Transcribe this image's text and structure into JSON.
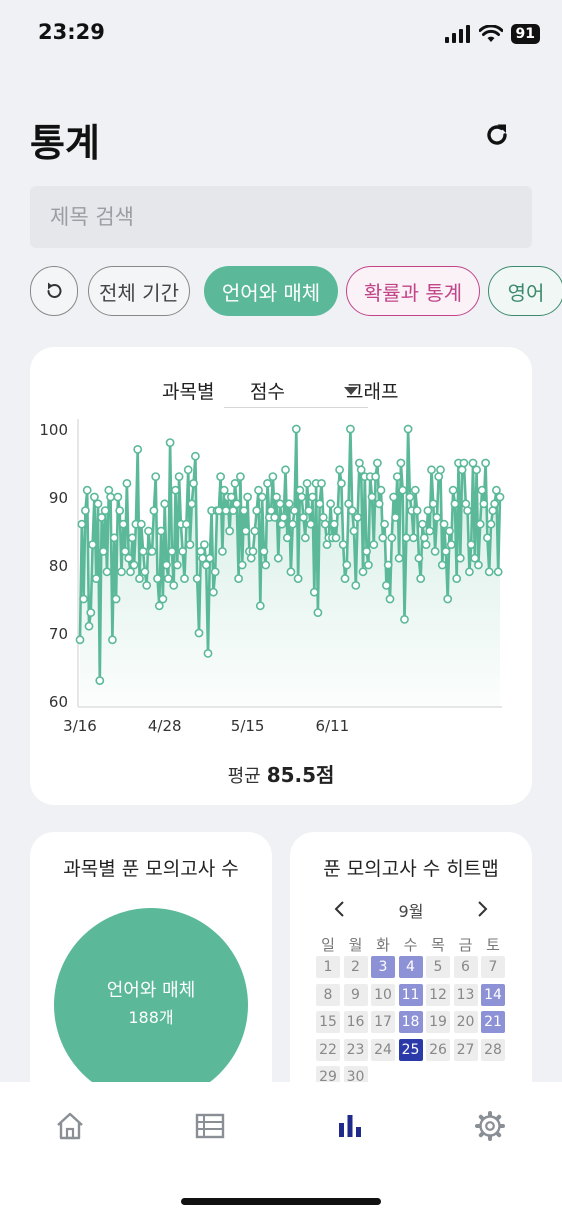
{
  "status_bar": {
    "time": "23:29",
    "battery": "91"
  },
  "header": {
    "title": "통계"
  },
  "search": {
    "placeholder": "제목 검색",
    "value": ""
  },
  "filters": {
    "reset_icon": "undo-icon",
    "chips": [
      {
        "label": "전체 기간",
        "active": false,
        "color": "#555555"
      },
      {
        "label": "언어와 매체",
        "active": true,
        "color": "#5bb99a"
      },
      {
        "label": "확률과 통계",
        "active": false,
        "color": "#c2458a"
      },
      {
        "label": "영어",
        "active": false,
        "color": "#3c8a6e"
      }
    ]
  },
  "chart_section": {
    "prefix": "과목별",
    "metric": "점수",
    "suffix": "그래프",
    "average_label": "평균",
    "average_value": "85.5점"
  },
  "chart_data": {
    "type": "line",
    "color": "#5bb99a",
    "ylim": [
      60,
      100
    ],
    "yticks": [
      60,
      70,
      80,
      90,
      100
    ],
    "xticks": [
      {
        "index": 0,
        "label": "3/16"
      },
      {
        "index": 47,
        "label": "4/28"
      },
      {
        "index": 93,
        "label": "5/15"
      },
      {
        "index": 140,
        "label": "6/11"
      }
    ],
    "values": [
      69,
      86,
      75,
      88,
      91,
      71,
      73,
      83,
      90,
      78,
      89,
      63,
      87,
      82,
      88,
      79,
      91,
      90,
      69,
      84,
      75,
      90,
      88,
      79,
      86,
      82,
      92,
      81,
      79,
      84,
      80,
      86,
      97,
      78,
      86,
      82,
      79,
      77,
      85,
      82,
      82,
      88,
      93,
      78,
      74,
      85,
      75,
      89,
      80,
      78,
      98,
      82,
      77,
      91,
      80,
      93,
      86,
      82,
      78,
      86,
      94,
      83,
      89,
      92,
      96,
      78,
      70,
      82,
      81,
      83,
      80,
      67,
      81,
      88,
      76,
      79,
      88,
      88,
      93,
      82,
      91,
      88,
      90,
      85,
      90,
      88,
      92,
      89,
      78,
      93,
      80,
      88,
      85,
      90,
      82,
      81,
      82,
      85,
      88,
      91,
      74,
      90,
      82,
      80,
      92,
      87,
      88,
      93,
      87,
      90,
      81,
      89,
      86,
      87,
      94,
      84,
      89,
      79,
      86,
      88,
      100,
      78,
      91,
      90,
      87,
      84,
      92,
      88,
      86,
      90,
      76,
      92,
      73,
      89,
      92,
      87,
      86,
      83,
      84,
      89,
      84,
      86,
      84,
      88,
      94,
      92,
      83,
      78,
      80,
      89,
      100,
      88,
      85,
      77,
      87,
      95,
      94,
      79,
      93,
      82,
      80,
      93,
      90,
      83,
      93,
      95,
      89,
      91,
      84,
      86,
      77,
      80,
      75,
      84,
      90,
      87,
      93,
      81,
      95,
      91,
      72,
      84,
      100,
      90,
      88,
      84,
      91,
      88,
      81,
      78,
      86,
      84,
      83,
      88,
      85,
      94,
      89,
      82,
      87,
      93,
      94,
      80,
      86,
      82,
      75,
      85,
      83,
      91,
      89,
      78,
      95,
      81,
      94,
      95,
      89,
      88,
      79,
      83,
      95,
      81,
      94,
      80,
      86,
      91,
      89,
      95,
      84,
      79,
      86,
      88,
      89,
      91,
      79,
      90
    ],
    "grid": false
  },
  "subject_card": {
    "title": "과목별 푼 모의고사 수",
    "slice_label": "언어와 매체",
    "slice_count": "188개",
    "slice_color": "#5bb99a"
  },
  "heatmap_card": {
    "title": "푼 모의고사 수 히트맵",
    "month": "9월",
    "weekdays": [
      "일",
      "월",
      "화",
      "수",
      "목",
      "금",
      "토"
    ],
    "leading_blanks": 0,
    "days": [
      "1",
      "2",
      "3",
      "4",
      "5",
      "6",
      "7",
      "8",
      "9",
      "10",
      "11",
      "12",
      "13",
      "14",
      "15",
      "16",
      "17",
      "18",
      "19",
      "20",
      "21",
      "22",
      "23",
      "24",
      "25",
      "26",
      "27",
      "28",
      "29",
      "30"
    ],
    "levels": [
      0,
      0,
      2,
      2,
      0,
      0,
      0,
      0,
      0,
      0,
      2,
      0,
      0,
      2,
      0,
      0,
      0,
      2,
      0,
      0,
      2,
      0,
      0,
      0,
      4,
      0,
      0,
      0,
      0,
      0
    ],
    "level_colors": [
      "#ededed",
      "#c6c8ec",
      "#8d91d6",
      "#6a6fcb",
      "#2a3aa8"
    ]
  },
  "bottom_nav": [
    {
      "icon": "home-icon",
      "active": false
    },
    {
      "icon": "list-icon",
      "active": false
    },
    {
      "icon": "bar-chart-icon",
      "active": true
    },
    {
      "icon": "gear-icon",
      "active": false
    }
  ]
}
